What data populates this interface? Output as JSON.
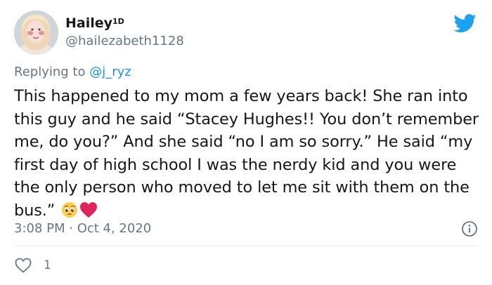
{
  "tweet": {
    "author_name": "Hailey",
    "author_badge": "1D",
    "handle": "@hailezabeth1128",
    "reply_prefix": "Replying to ",
    "reply_to": "@j_ryz",
    "text": "This happened to my mom a few years back! She ran into this guy and he said “Stacey Hughes!! You don’t remember me, do you?” And she said “no I am so sorry.” He said “my first day of high school I was the nerdy kid and you were the only person who moved to let me sit with them on the bus.”",
    "timestamp": "3:08 PM · Oct 4, 2020",
    "like_count": "1"
  },
  "icons": {
    "logo": "twitter-bird-icon",
    "info": "info-icon",
    "like": "heart-outline-icon",
    "emojis": [
      "pleading-face-emoji",
      "red-heart-emoji"
    ]
  },
  "colors": {
    "brand": "#1da1f2",
    "mention": "#1b95e0",
    "secondary_text": "#657786",
    "heart_emoji": "#e0245e"
  }
}
